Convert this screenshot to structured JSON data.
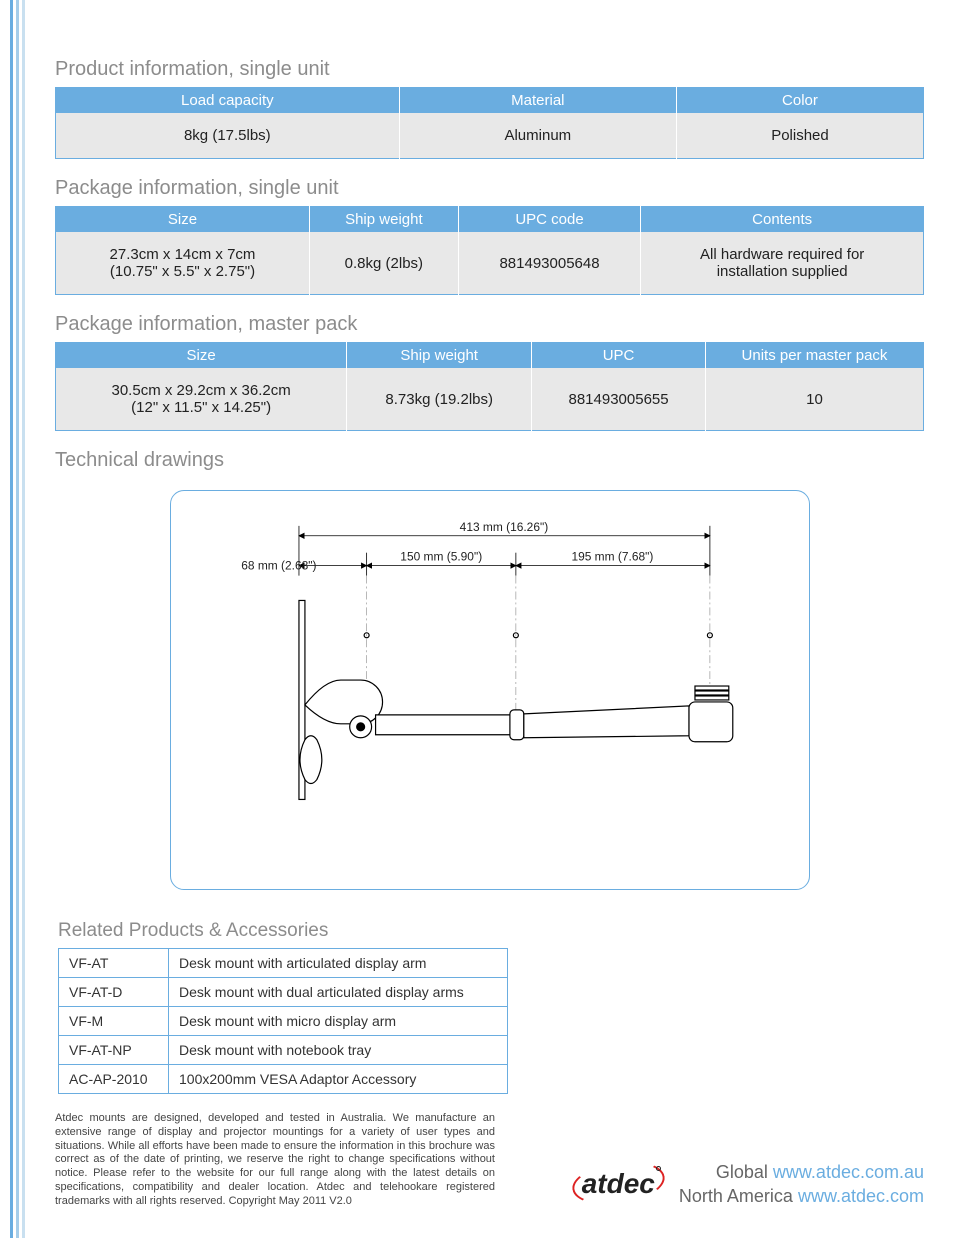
{
  "sections": {
    "product_single": {
      "title": "Product information, single unit",
      "headers": [
        "Load capacity",
        "Material",
        "Color"
      ],
      "row": [
        "8kg (17.5lbs)",
        "Aluminum",
        "Polished"
      ]
    },
    "package_single": {
      "title": "Package information, single unit",
      "headers": [
        "Size",
        "Ship weight",
        "UPC code",
        "Contents"
      ],
      "row": {
        "size_l1": "27.3cm x 14cm x 7cm",
        "size_l2": "(10.75\" x 5.5\" x 2.75\")",
        "weight": "0.8kg (2lbs)",
        "upc": "881493005648",
        "contents_l1": "All hardware required for",
        "contents_l2": "installation supplied"
      }
    },
    "package_master": {
      "title": "Package information, master pack",
      "headers": [
        "Size",
        "Ship weight",
        "UPC",
        "Units per master pack"
      ],
      "row": {
        "size_l1": "30.5cm x 29.2cm x 36.2cm",
        "size_l2": "(12\" x 11.5\" x 14.25\")",
        "weight": "8.73kg (19.2lbs)",
        "upc": "881493005655",
        "units": "10"
      }
    },
    "drawings_title": "Technical drawings",
    "drawing_dims": {
      "total": "413 mm (16.26\")",
      "seg1": "68 mm (2.68\")",
      "seg2": "150 mm (5.90\")",
      "seg3": "195 mm (7.68\")"
    },
    "related": {
      "title": "Related Products & Accessories",
      "rows": [
        {
          "code": "VF-AT",
          "desc": "Desk mount with articulated display arm"
        },
        {
          "code": "VF-AT-D",
          "desc": "Desk mount with dual articulated display arms"
        },
        {
          "code": "VF-M",
          "desc": "Desk mount with micro display arm"
        },
        {
          "code": "VF-AT-NP",
          "desc": "Desk mount with notebook tray"
        },
        {
          "code": "AC-AP-2010",
          "desc": "100x200mm VESA Adaptor Accessory"
        }
      ]
    }
  },
  "footer": {
    "disclaimer": "Atdec mounts are designed, developed and tested in Australia. We manufacture an extensive range of display and projector mountings for a variety of user types and situations. While all efforts have been made to ensure the information in this brochure was correct as of the date of printing, we reserve the right to change specifications without notice. Please refer to the website for our full range along with the latest details on specifications, compatibility and dealer location. Atdec and telehookare registered trademarks with all rights reserved. Copyright May 2011 V2.0",
    "logo_text": "atdec",
    "global_label": "Global",
    "global_url": "www.atdec.com.au",
    "na_label": "North America",
    "na_url": "www.atdec.com"
  }
}
